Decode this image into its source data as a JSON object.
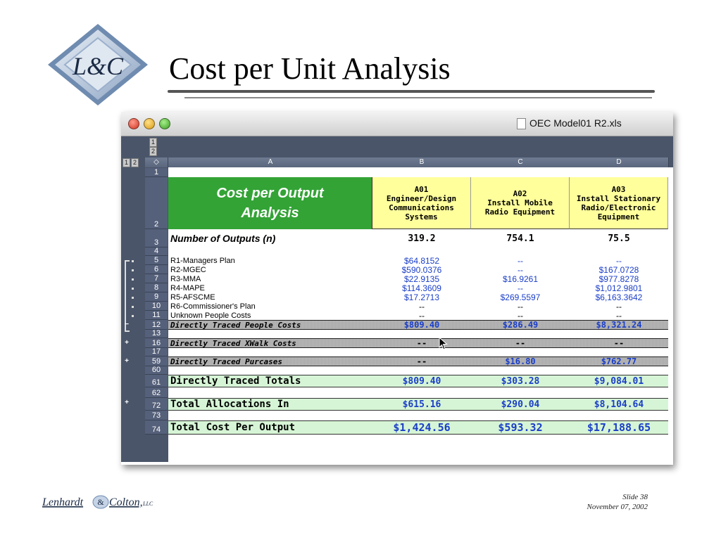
{
  "slide": {
    "title": "Cost per Unit Analysis",
    "logo_text": "L&C",
    "footer_company": "Lenhardt & Colton, LLC",
    "footer_company_parts": [
      "Lenhardt",
      "&",
      "Colton,",
      "LLC"
    ],
    "slide_label": "Slide 38",
    "date": "November 07, 2002"
  },
  "window": {
    "title": "OEC Model01 R2.xls",
    "outline_levels": [
      "1",
      "2"
    ],
    "column_headers": [
      "A",
      "B",
      "C",
      "D"
    ],
    "corner_symbol": "◇"
  },
  "sheet": {
    "header_title_line1": "Cost per Output",
    "header_title_line2": "Analysis",
    "columns": [
      {
        "code": "A01",
        "lines": [
          "Engineer/Design",
          "Communications",
          "Systems"
        ]
      },
      {
        "code": "A02",
        "lines": [
          "Install Mobile",
          "Radio Equipment"
        ]
      },
      {
        "code": "A03",
        "lines": [
          "Install Stationary",
          "Radio/Electronic",
          "Equipment"
        ]
      }
    ],
    "rows": [
      {
        "num": "1",
        "label": "",
        "values": [
          "",
          "",
          ""
        ],
        "style": "blank"
      },
      {
        "num": "3",
        "label": "Number of Outputs (n)",
        "values": [
          "319.2",
          "754.1",
          "75.5"
        ],
        "style": "outputs"
      },
      {
        "num": "4",
        "label": "",
        "values": [
          "",
          "",
          ""
        ],
        "style": "blank"
      },
      {
        "num": "5",
        "label": "R1-Managers Plan",
        "values": [
          "$64.8152",
          "--",
          "--"
        ],
        "style": "detail"
      },
      {
        "num": "6",
        "label": "R2-MGEC",
        "values": [
          "$590.0376",
          "--",
          "$167.0728"
        ],
        "style": "detail"
      },
      {
        "num": "7",
        "label": "R3-MMA",
        "values": [
          "$22.9135",
          "$16.9261",
          "$977.8278"
        ],
        "style": "detail"
      },
      {
        "num": "8",
        "label": "R4-MAPE",
        "values": [
          "$114.3609",
          "--",
          "$1,012.9801"
        ],
        "style": "detail"
      },
      {
        "num": "9",
        "label": "R5-AFSCME",
        "values": [
          "$17.2713",
          "$269.5597",
          "$6,163.3642"
        ],
        "style": "detail"
      },
      {
        "num": "10",
        "label": "R6-Commissioner's Plan",
        "values": [
          "--",
          "--",
          "--"
        ],
        "style": "detail-black"
      },
      {
        "num": "11",
        "label": "Unknown People Costs",
        "values": [
          "--",
          "--",
          "--"
        ],
        "style": "detail-black"
      },
      {
        "num": "12",
        "label": "Directly Traced People Costs",
        "values": [
          "$809.40",
          "$286.49",
          "$8,321.24"
        ],
        "style": "gray"
      },
      {
        "num": "13",
        "label": "",
        "values": [
          "",
          "",
          ""
        ],
        "style": "blank"
      },
      {
        "num": "16",
        "label": "Directly Traced XWalk Costs",
        "values": [
          "--",
          "--",
          "--"
        ],
        "style": "gray"
      },
      {
        "num": "17",
        "label": "",
        "values": [
          "",
          "",
          ""
        ],
        "style": "blank"
      },
      {
        "num": "59",
        "label": "Directly Traced Purcases",
        "values": [
          "--",
          "$16.80",
          "$762.77"
        ],
        "style": "gray"
      },
      {
        "num": "60",
        "label": "",
        "values": [
          "",
          "",
          ""
        ],
        "style": "blank"
      },
      {
        "num": "61",
        "label": "Directly Traced Totals",
        "values": [
          "$809.40",
          "$303.28",
          "$9,084.01"
        ],
        "style": "mint"
      },
      {
        "num": "62",
        "label": "",
        "values": [
          "",
          "",
          ""
        ],
        "style": "blank"
      },
      {
        "num": "72",
        "label": "Total Allocations In",
        "values": [
          "$615.16",
          "$290.04",
          "$8,104.64"
        ],
        "style": "mint"
      },
      {
        "num": "73",
        "label": "",
        "values": [
          "",
          "",
          ""
        ],
        "style": "blank"
      },
      {
        "num": "74",
        "label": "Total Cost Per Output",
        "values": [
          "$1,424.56",
          "$593.32",
          "$17,188.65"
        ],
        "style": "mint-big"
      }
    ],
    "header_row_num": "2"
  },
  "colors": {
    "green_header": "#33a336",
    "yellow_header": "#ffff9c",
    "mint_total": "#d6f5d6",
    "value_blue": "#1a3ec8"
  }
}
